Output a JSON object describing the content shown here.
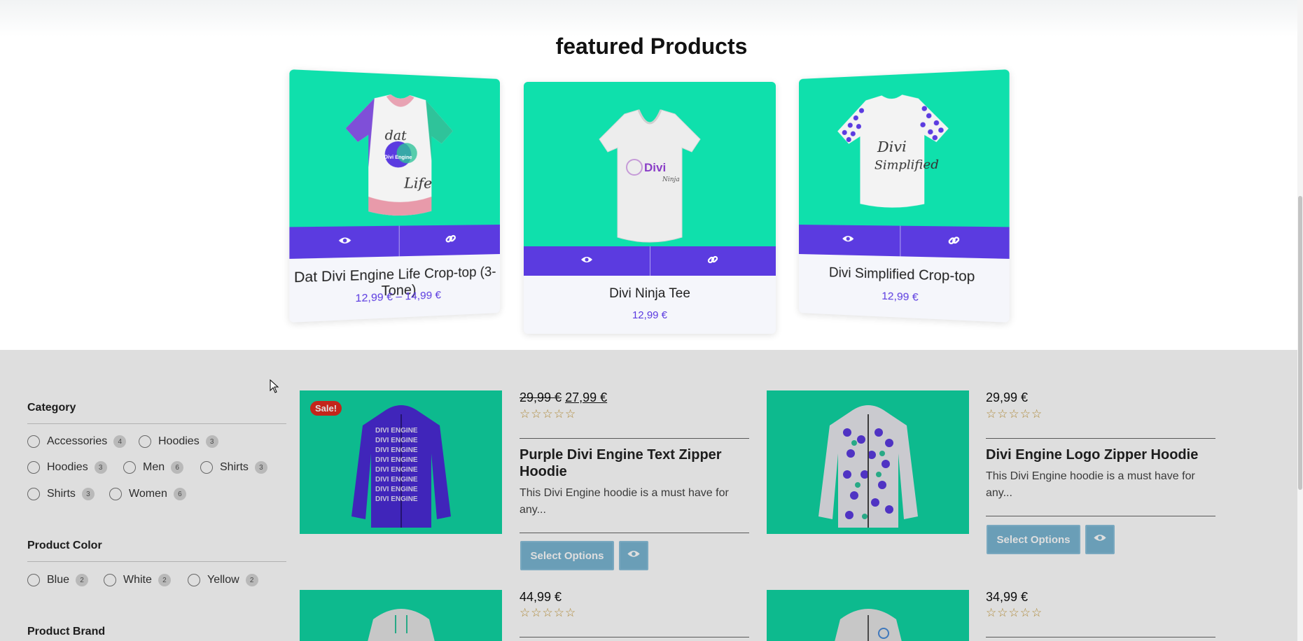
{
  "featured": {
    "title": "featured Products",
    "cards": [
      {
        "name": "Dat Divi Engine Life Crop-top (3-Tone)",
        "price": "12,99 € – 14,99 €"
      },
      {
        "name": "Divi Ninja Tee",
        "price": "12,99 €"
      },
      {
        "name": "Divi Simplified Crop-top",
        "price": "12,99 €"
      }
    ]
  },
  "filters": {
    "category": {
      "title": "Category",
      "options": [
        {
          "label": "Accessories",
          "count": "4"
        },
        {
          "label": "Hoodies",
          "count": "3"
        },
        {
          "label": "Hoodies",
          "count": "3"
        },
        {
          "label": "Men",
          "count": "6"
        },
        {
          "label": "Shirts",
          "count": "3"
        },
        {
          "label": "Shirts",
          "count": "3"
        },
        {
          "label": "Women",
          "count": "6"
        }
      ]
    },
    "color": {
      "title": "Product Color",
      "options": [
        {
          "label": "Blue",
          "count": "2"
        },
        {
          "label": "White",
          "count": "2"
        },
        {
          "label": "Yellow",
          "count": "2"
        }
      ]
    },
    "brand": {
      "title": "Product Brand"
    }
  },
  "products": [
    {
      "old_price": "29,99 €",
      "price": "27,99 €",
      "badge": "Sale!",
      "title": "Purple Divi Engine Text Zipper Hoodie",
      "desc": "This Divi Engine hoodie is a must have for any...",
      "button": "Select Options"
    },
    {
      "price": "29,99 €",
      "title": "Divi Engine Logo Zipper Hoodie",
      "desc": "This Divi Engine hoodie is a must have for any...",
      "button": "Select Options"
    },
    {
      "price": "44,99 €"
    },
    {
      "price": "34,99 €"
    }
  ],
  "tee_prints": {
    "dat_top": "dat",
    "dat_logo": "Divi Engine",
    "dat_bottom": "Life",
    "ninja": "Divi",
    "ninja_sub": "Ninja",
    "simplified_1": "Divi",
    "simplified_2": "Simplified",
    "hoodie_text": "DIVI ENGINE"
  },
  "icons": [
    "eye-icon",
    "link-icon",
    "star-icon",
    "cursor-icon"
  ],
  "colors": {
    "accent": "#5b3be0",
    "mint": "#0fe0ac",
    "sale": "#e02b20",
    "button": "#7ab6d3",
    "star": "#c89b3c"
  }
}
